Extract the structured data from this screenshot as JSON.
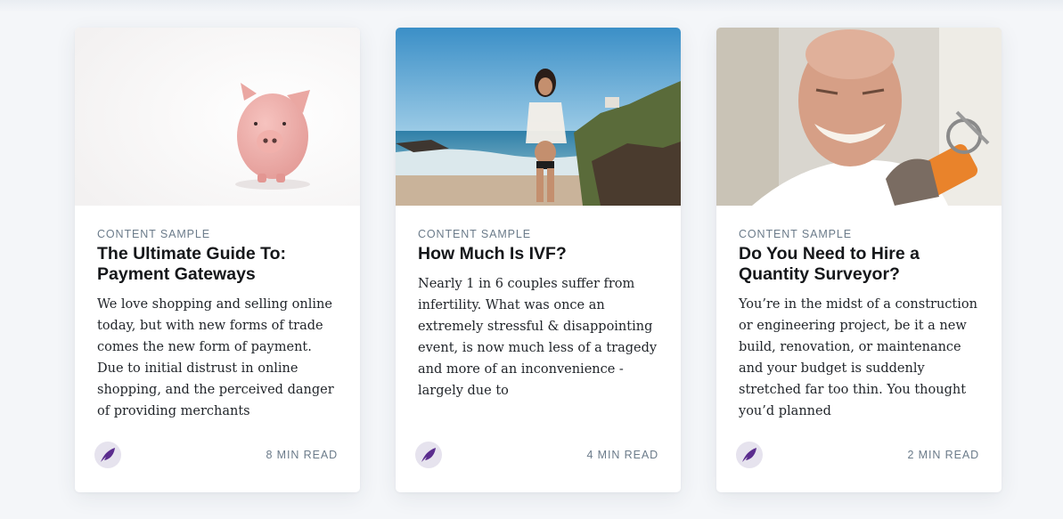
{
  "cards": [
    {
      "tag": "Content Sample",
      "title": "The Ultimate Guide To: Payment Gateways",
      "excerpt": "We love shopping and selling online today, but with new forms of trade comes the new form of payment. Due to initial distrust in online shopping, and the perceived danger of providing merchants",
      "read_time": "8 min read",
      "image": "piggy-bank-photo"
    },
    {
      "tag": "Content Sample",
      "title": "How Much Is IVF?",
      "excerpt": "Nearly 1 in 6 couples suffer from infertility. What was once an extremely stressful & disappointing event, is now much less of a tragedy and more of an inconvenience - largely due to",
      "read_time": "4 min read",
      "image": "beach-pregnant-woman-photo"
    },
    {
      "tag": "Content Sample",
      "title": "Do You Need to Hire a Quantity Surveyor?",
      "excerpt": "You’re in the midst of a construction or engineering project, be it a new build, renovation, or maintenance and your budget is suddenly stretched far too thin. You thought you’d planned",
      "read_time": "2 min read",
      "image": "smiling-worker-photo"
    }
  ],
  "colors": {
    "accent": "#5b2d8e",
    "tag": "#6b7b8a",
    "title": "#15171a"
  }
}
